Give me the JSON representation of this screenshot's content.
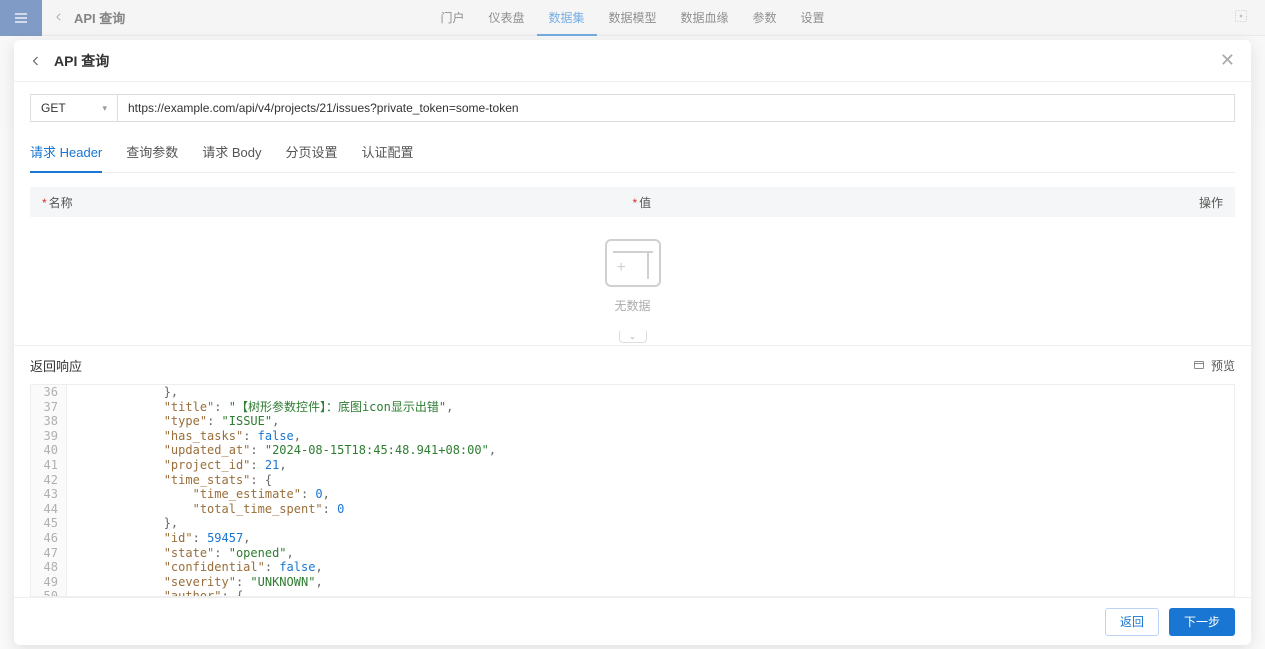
{
  "bgHeader": {
    "title": "API 查询",
    "nav": [
      "门户",
      "仪表盘",
      "数据集",
      "数据模型",
      "数据血缘",
      "参数",
      "设置"
    ],
    "navActiveIndex": 2
  },
  "panel": {
    "title": "API 查询"
  },
  "request": {
    "method": "GET",
    "url": "https://example.com/api/v4/projects/21/issues?private_token=some-token"
  },
  "subTabs": [
    "请求 Header",
    "查询参数",
    "请求 Body",
    "分页设置",
    "认证配置"
  ],
  "subTabActiveIndex": 0,
  "tableHeaders": {
    "name": "名称",
    "value": "值",
    "actions": "操作"
  },
  "empty": {
    "label": "无数据"
  },
  "response": {
    "title": "返回响应",
    "preview": "预览"
  },
  "codeLines": [
    {
      "n": 36,
      "indent": 3,
      "tokens": [
        {
          "t": "punc",
          "v": "},"
        }
      ]
    },
    {
      "n": 37,
      "indent": 3,
      "tokens": [
        {
          "t": "key",
          "v": "\"title\""
        },
        {
          "t": "punc",
          "v": ": "
        },
        {
          "t": "str",
          "v": "\"【树形参数控件】：底图icon显示出错\""
        },
        {
          "t": "punc",
          "v": ","
        }
      ]
    },
    {
      "n": 38,
      "indent": 3,
      "tokens": [
        {
          "t": "key",
          "v": "\"type\""
        },
        {
          "t": "punc",
          "v": ": "
        },
        {
          "t": "str",
          "v": "\"ISSUE\""
        },
        {
          "t": "punc",
          "v": ","
        }
      ]
    },
    {
      "n": 39,
      "indent": 3,
      "tokens": [
        {
          "t": "key",
          "v": "\"has_tasks\""
        },
        {
          "t": "punc",
          "v": ": "
        },
        {
          "t": "bool",
          "v": "false"
        },
        {
          "t": "punc",
          "v": ","
        }
      ]
    },
    {
      "n": 40,
      "indent": 3,
      "tokens": [
        {
          "t": "key",
          "v": "\"updated_at\""
        },
        {
          "t": "punc",
          "v": ": "
        },
        {
          "t": "str",
          "v": "\"2024-08-15T18:45:48.941+08:00\""
        },
        {
          "t": "punc",
          "v": ","
        }
      ]
    },
    {
      "n": 41,
      "indent": 3,
      "tokens": [
        {
          "t": "key",
          "v": "\"project_id\""
        },
        {
          "t": "punc",
          "v": ": "
        },
        {
          "t": "num",
          "v": "21"
        },
        {
          "t": "punc",
          "v": ","
        }
      ]
    },
    {
      "n": 42,
      "indent": 3,
      "tokens": [
        {
          "t": "key",
          "v": "\"time_stats\""
        },
        {
          "t": "punc",
          "v": ": {"
        }
      ]
    },
    {
      "n": 43,
      "indent": 4,
      "tokens": [
        {
          "t": "key",
          "v": "\"time_estimate\""
        },
        {
          "t": "punc",
          "v": ": "
        },
        {
          "t": "num",
          "v": "0"
        },
        {
          "t": "punc",
          "v": ","
        }
      ]
    },
    {
      "n": 44,
      "indent": 4,
      "tokens": [
        {
          "t": "key",
          "v": "\"total_time_spent\""
        },
        {
          "t": "punc",
          "v": ": "
        },
        {
          "t": "num",
          "v": "0"
        }
      ]
    },
    {
      "n": 45,
      "indent": 3,
      "tokens": [
        {
          "t": "punc",
          "v": "},"
        }
      ]
    },
    {
      "n": 46,
      "indent": 3,
      "tokens": [
        {
          "t": "key",
          "v": "\"id\""
        },
        {
          "t": "punc",
          "v": ": "
        },
        {
          "t": "num",
          "v": "59457"
        },
        {
          "t": "punc",
          "v": ","
        }
      ]
    },
    {
      "n": 47,
      "indent": 3,
      "tokens": [
        {
          "t": "key",
          "v": "\"state\""
        },
        {
          "t": "punc",
          "v": ": "
        },
        {
          "t": "str",
          "v": "\"opened\""
        },
        {
          "t": "punc",
          "v": ","
        }
      ]
    },
    {
      "n": 48,
      "indent": 3,
      "tokens": [
        {
          "t": "key",
          "v": "\"confidential\""
        },
        {
          "t": "punc",
          "v": ": "
        },
        {
          "t": "bool",
          "v": "false"
        },
        {
          "t": "punc",
          "v": ","
        }
      ]
    },
    {
      "n": 49,
      "indent": 3,
      "tokens": [
        {
          "t": "key",
          "v": "\"severity\""
        },
        {
          "t": "punc",
          "v": ": "
        },
        {
          "t": "str",
          "v": "\"UNKNOWN\""
        },
        {
          "t": "punc",
          "v": ","
        }
      ]
    },
    {
      "n": 50,
      "indent": 3,
      "tokens": [
        {
          "t": "key",
          "v": "\"author\""
        },
        {
          "t": "punc",
          "v": ": {"
        }
      ]
    }
  ],
  "footer": {
    "back": "返回",
    "next": "下一步"
  }
}
